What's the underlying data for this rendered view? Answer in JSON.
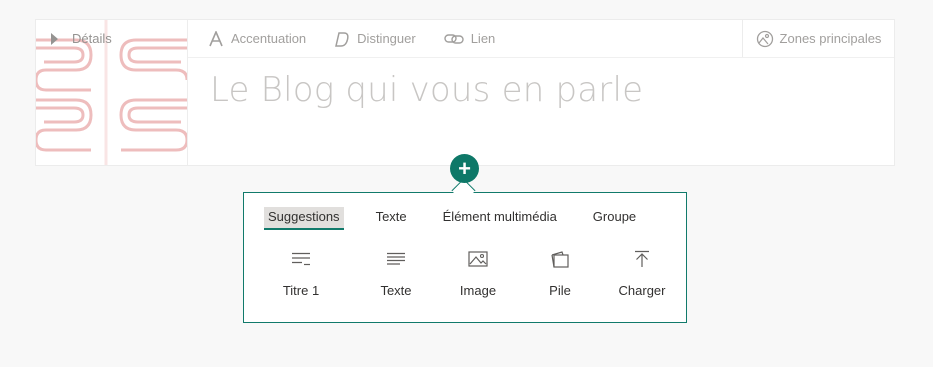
{
  "header": {
    "details_label": "Détails",
    "toolbar": [
      {
        "label": "Accentuation",
        "icon": "accent-icon"
      },
      {
        "label": "Distinguer",
        "icon": "italic-d-icon"
      },
      {
        "label": "Lien",
        "icon": "link-icon"
      }
    ],
    "zones_label": "Zones principales",
    "title": "Le Blog qui vous en parle"
  },
  "panel": {
    "tabs": [
      "Suggestions",
      "Texte",
      "Élément multimédia",
      "Groupe"
    ],
    "active_tab": "Suggestions",
    "items": [
      {
        "label": "Titre 1",
        "icon": "heading-icon"
      },
      {
        "label": "Texte",
        "icon": "text-icon"
      },
      {
        "label": "Image",
        "icon": "image-icon"
      },
      {
        "label": "Pile",
        "icon": "stack-icon"
      },
      {
        "label": "Charger",
        "icon": "upload-icon"
      }
    ]
  },
  "colors": {
    "accent": "#117a6b",
    "thumb_pattern": "#e8a3a3"
  }
}
